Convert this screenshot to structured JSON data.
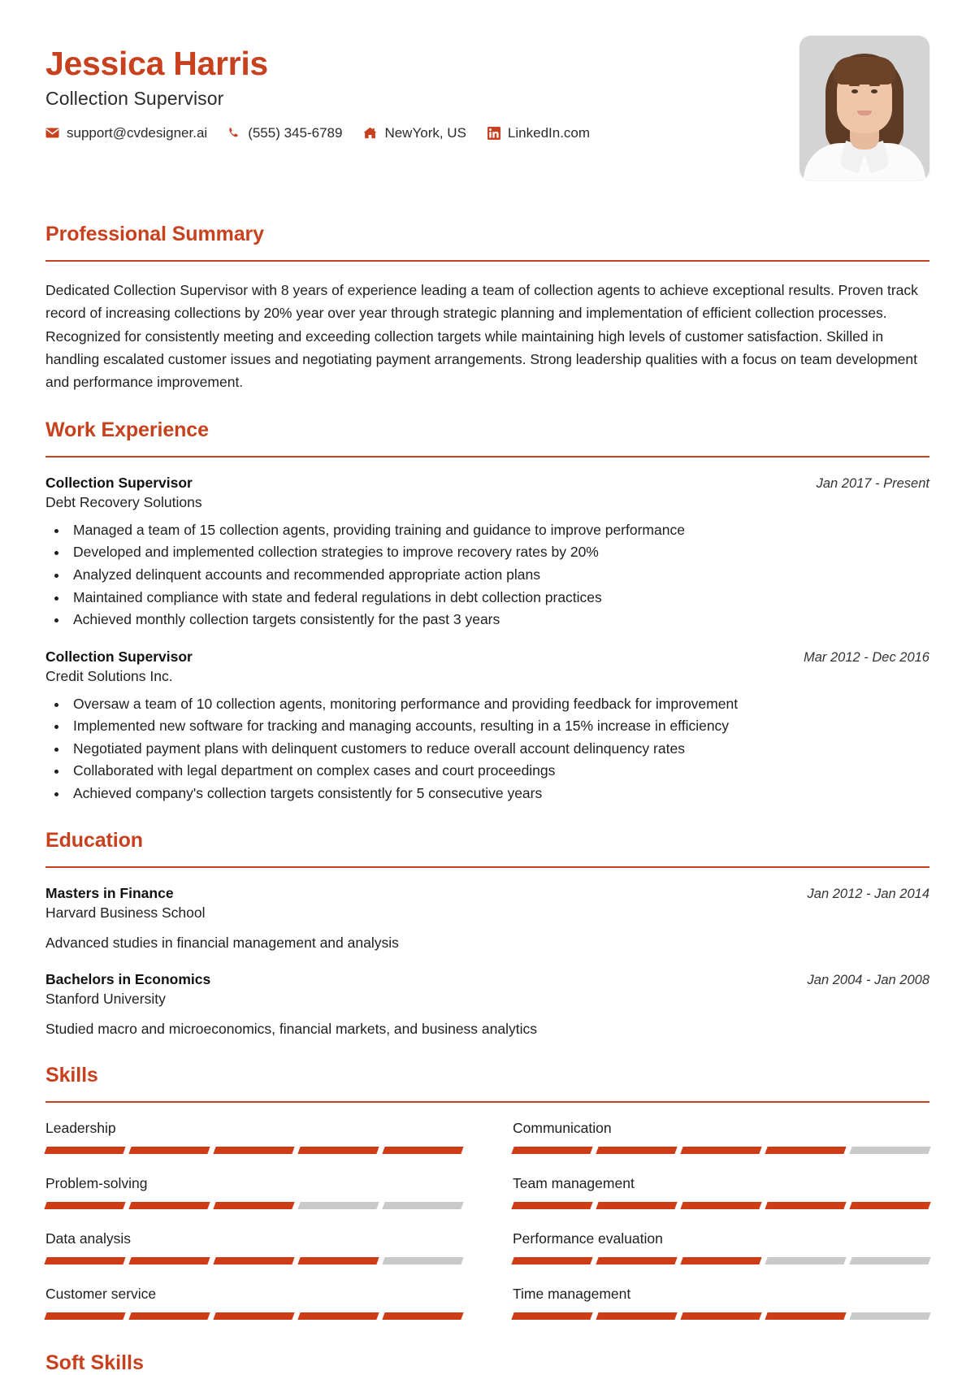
{
  "header": {
    "name": "Jessica Harris",
    "job_title": "Collection Supervisor",
    "contacts": [
      {
        "icon": "email-icon",
        "text": "support@cvdesigner.ai"
      },
      {
        "icon": "phone-icon",
        "text": "(555) 345-6789"
      },
      {
        "icon": "home-icon",
        "text": "NewYork, US"
      },
      {
        "icon": "linkedin-icon",
        "text": "LinkedIn.com"
      }
    ],
    "photo_alt": "profile-photo"
  },
  "accent_color": "#C8411F",
  "bar_on_color": "#CC3D15",
  "bar_off_color": "#C9C9C9",
  "sections": {
    "summary": {
      "title": "Professional Summary",
      "text": "Dedicated Collection Supervisor with 8 years of experience leading a team of collection agents to achieve exceptional results. Proven track record of increasing collections by 20% year over year through strategic planning and implementation of efficient collection processes. Recognized for consistently meeting and exceeding collection targets while maintaining high levels of customer satisfaction. Skilled in handling escalated customer issues and negotiating payment arrangements. Strong leadership qualities with a focus on team development and performance improvement."
    },
    "experience": {
      "title": "Work Experience",
      "entries": [
        {
          "role": "Collection Supervisor",
          "org": "Debt Recovery Solutions",
          "date": "Jan 2017 - Present",
          "bullets": [
            "Managed a team of 15 collection agents, providing training and guidance to improve performance",
            "Developed and implemented collection strategies to improve recovery rates by 20%",
            "Analyzed delinquent accounts and recommended appropriate action plans",
            "Maintained compliance with state and federal regulations in debt collection practices",
            "Achieved monthly collection targets consistently for the past 3 years"
          ]
        },
        {
          "role": "Collection Supervisor",
          "org": "Credit Solutions Inc.",
          "date": "Mar 2012 - Dec 2016",
          "bullets": [
            "Oversaw a team of 10 collection agents, monitoring performance and providing feedback for improvement",
            "Implemented new software for tracking and managing accounts, resulting in a 15% increase in efficiency",
            "Negotiated payment plans with delinquent customers to reduce overall account delinquency rates",
            "Collaborated with legal department on complex cases and court proceedings",
            "Achieved company's collection targets consistently for 5 consecutive years"
          ]
        }
      ]
    },
    "education": {
      "title": "Education",
      "entries": [
        {
          "degree": "Masters in Finance",
          "school": "Harvard Business School",
          "date": "Jan 2012 - Jan 2014",
          "description": "Advanced studies in financial management and analysis"
        },
        {
          "degree": "Bachelors in Economics",
          "school": "Stanford University",
          "date": "Jan 2004 - Jan 2008",
          "description": "Studied macro and microeconomics, financial markets, and business analytics"
        }
      ]
    },
    "skills": {
      "title": "Skills",
      "max_level": 5,
      "items": [
        {
          "name": "Leadership",
          "level": 5
        },
        {
          "name": "Communication",
          "level": 4
        },
        {
          "name": "Problem-solving",
          "level": 3
        },
        {
          "name": "Team management",
          "level": 5
        },
        {
          "name": "Data analysis",
          "level": 4
        },
        {
          "name": "Performance evaluation",
          "level": 3
        },
        {
          "name": "Customer service",
          "level": 5
        },
        {
          "name": "Time management",
          "level": 4
        }
      ]
    },
    "soft_skills": {
      "title": "Soft Skills"
    }
  }
}
